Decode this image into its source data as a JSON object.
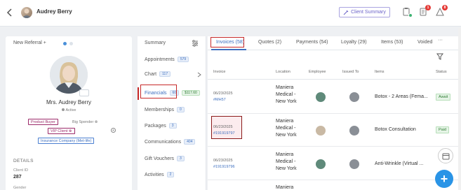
{
  "header": {
    "patient_name": "Audrey Berry",
    "client_summary_label": "Client Summary",
    "forms_badge": "1",
    "alerts_badge": "8"
  },
  "profile": {
    "new_referral_label": "New Referral +",
    "name": "Mrs. Audrey Berry",
    "status": "Active",
    "tags": {
      "product_buyer": "Product Buyer",
      "big_spender": "Big Spender ⊗",
      "vip_client": "VIP Client ⊗",
      "insurance": "Insurance Company (Met-life)"
    },
    "details_heading": "DETAILS",
    "client_id_label": "Client ID",
    "client_id_value": "287",
    "gender_label": "Gender"
  },
  "nav": {
    "items": [
      {
        "label": "Summary",
        "badge": ""
      },
      {
        "label": "Appointments",
        "badge": "579"
      },
      {
        "label": "Chart",
        "badge": "117"
      },
      {
        "label": "Financials",
        "badge": "60",
        "extra": "$117.60"
      },
      {
        "label": "Memberships",
        "badge": "0"
      },
      {
        "label": "Packages",
        "badge": "3"
      },
      {
        "label": "Communications",
        "badge": "404"
      },
      {
        "label": "Gift Vouchers",
        "badge": "3"
      },
      {
        "label": "Activities",
        "badge": "2"
      }
    ]
  },
  "tabs": [
    {
      "label": "Invoices (58)"
    },
    {
      "label": "Quotes (2)"
    },
    {
      "label": "Payments (54)"
    },
    {
      "label": "Loyalty (29)"
    },
    {
      "label": "Items (53)"
    },
    {
      "label": "Voided"
    }
  ],
  "more_label": "···",
  "table": {
    "headers": [
      "Invoice",
      "Location",
      "Employee",
      "Issued To",
      "Items",
      "Status"
    ],
    "rows": [
      {
        "date": "06/23/2025",
        "invoice": "#MH57",
        "location": [
          "Maniera",
          "Medical -",
          "New York"
        ],
        "items": "Botox - 2 Areas (Fema...",
        "status": "Await"
      },
      {
        "date": "06/23/2025",
        "invoice": "#191919797",
        "location": [
          "Maniera",
          "Medical -",
          "New York"
        ],
        "items": "Botox Consultation",
        "status": "Paid"
      },
      {
        "date": "06/23/2025",
        "invoice": "#191919796",
        "location": [
          "Maniera",
          "Medical -",
          "New York"
        ],
        "items": "Anti-Wrinkle (Virtual ...",
        "status": ""
      },
      {
        "date": "",
        "invoice": "",
        "location": [
          "Maniera"
        ],
        "items": "",
        "status": ""
      }
    ]
  }
}
